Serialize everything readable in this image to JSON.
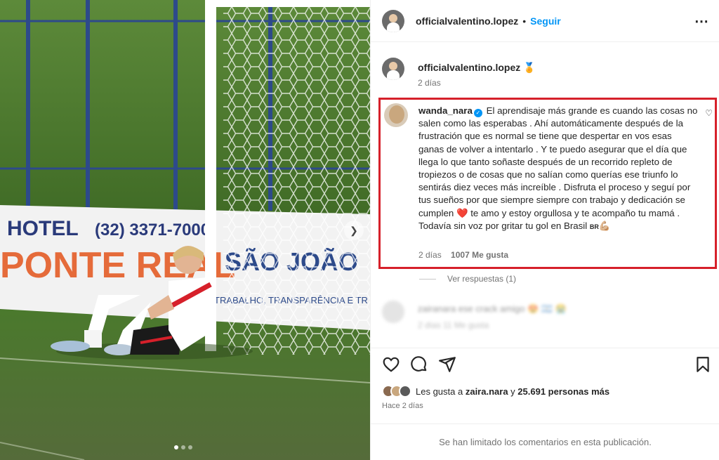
{
  "carousel": {
    "next_icon": "chevron-right-icon",
    "slide_count": 3,
    "active_slide": 1
  },
  "post_header": {
    "username": "officialvalentino.lopez",
    "separator": "•",
    "follow_label": "Seguir",
    "more_icon": "more-icon"
  },
  "caption": {
    "username": "officialvalentino.lopez",
    "badge_icon": "medal-icon",
    "age": "2 días"
  },
  "highlighted_comment": {
    "username": "wanda_nara",
    "text_part1": "El aprendisaje más grande es cuando las cosas no salen como las esperabas . Ahí automáticamente después de la frustración que es normal se tiene que despertar en vos esas ganas de volver a intentarlo . Y te puedo asegurar que el día que llega lo que tanto soñaste después de un recorrido repleto de tropiezos o de cosas que no salían como querías ese triunfo lo sentirás diez veces más increíble . Disfruta el proceso y seguí por tus sueños por que siempre siempre con trabajo y dedicación se cumplen",
    "heart": "❤️",
    "text_part2": "te amo y estoy orgullosa y te acompaño tu mamá . Todavía sin voz por gritar tu gol en Brasil",
    "flag": "BR",
    "muscle": "💪🏼",
    "age": "2 días",
    "likes": "1007 Me gusta",
    "highlight_color": "#d6202a"
  },
  "view_replies": "Ver respuestas (1)",
  "blurred_comment": {
    "text": "zairanara ese crack amigo 😍 🇦🇷 😭",
    "meta": "2 días   11 Me gusta"
  },
  "likes_summary": {
    "prefix": "Les gusta a",
    "user": "zaira.nara",
    "middle": "y",
    "count": "25.691 personas más"
  },
  "posted": "Hace 2 días",
  "comments_limited": "Se han limitado los comentarios en esta publicación.",
  "colors": {
    "accent": "#0095f6",
    "text": "#262626",
    "muted": "#737373"
  }
}
